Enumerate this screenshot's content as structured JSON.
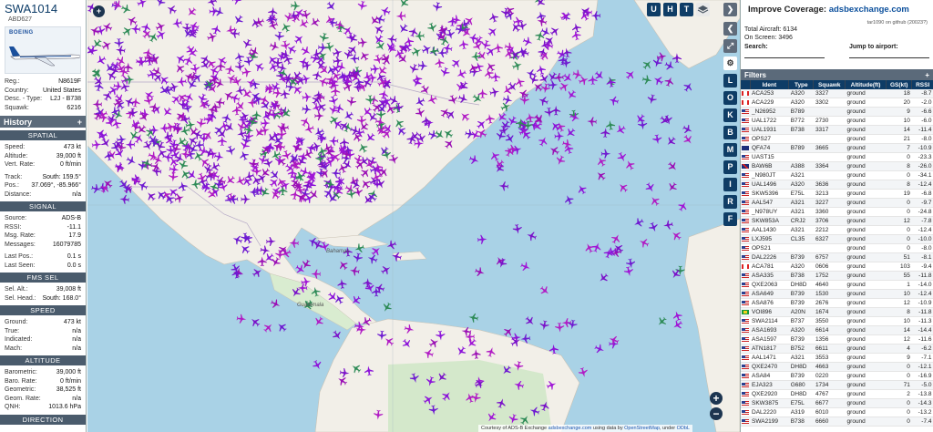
{
  "selected": {
    "callsign": "SWA1014",
    "hex": "ABD627",
    "airline_logo": "BOEING",
    "reg_label": "Reg.:",
    "reg": "N8619F",
    "country_label": "Country:",
    "country": "United States",
    "desc_label": "Desc. - Type:",
    "desc": "L2J - B738",
    "squawk_label": "Squawk:",
    "squawk": "6216"
  },
  "history": {
    "label": "History",
    "add": "+"
  },
  "spatial": {
    "title": "SPATIAL",
    "speed_label": "Speed:",
    "speed": "473 kt",
    "alt_label": "Altitude:",
    "alt": "39,000 ft",
    "vrate_label": "Vert. Rate:",
    "vrate": "0 ft/min",
    "track_label": "Track:",
    "track": "South: 159.5°",
    "pos_label": "Pos.:",
    "pos": "37.069°, -85.966°",
    "dist_label": "Distance:",
    "dist": "n/a"
  },
  "signal": {
    "title": "SIGNAL",
    "source_label": "Source:",
    "source": "ADS-B",
    "rssi_label": "RSSI:",
    "rssi": "-11.1",
    "msgrate_label": "Msg. Rate:",
    "msgrate": "17.9",
    "messages_label": "Messages:",
    "messages": "16079785",
    "lastpos_label": "Last Pos.:",
    "lastpos": "0.1 s",
    "lastseen_label": "Last Seen:",
    "lastseen": "0.0 s"
  },
  "fms": {
    "title": "FMS SEL",
    "selalt_label": "Sel. Alt.:",
    "selalt": "39,008 ft",
    "selhead_label": "Sel. Head.:",
    "selhead": "South: 168.0°"
  },
  "speedsec": {
    "title": "SPEED",
    "ground_label": "Ground:",
    "ground": "473 kt",
    "true_label": "True:",
    "true": "n/a",
    "ind_label": "Indicated:",
    "ind": "n/a",
    "mach_label": "Mach:",
    "mach": "n/a"
  },
  "altitude": {
    "title": "ALTITUDE",
    "baro_label": "Barometric:",
    "baro": "39,000 ft",
    "barorate_label": "Baro. Rate:",
    "barorate": "0 ft/min",
    "geom_label": "Geometric:",
    "geom": "38,525 ft",
    "geomrate_label": "Geom. Rate:",
    "geomrate": "n/a",
    "qnh_label": "QNH:",
    "qnh": "1013.6 hPa"
  },
  "direction": {
    "title": "DIRECTION"
  },
  "map_buttons": {
    "u": "U",
    "h": "H",
    "t": "T",
    "plus": "+",
    "minus": "−"
  },
  "side_buttons": [
    "L",
    "O",
    "K",
    "B",
    "M",
    "P",
    "I",
    "R",
    "F"
  ],
  "map_places": {
    "bahamas": "Bahamas",
    "guatemala": "Guatemala"
  },
  "attribution": {
    "prefix": "Courtesy of ADS-B Exchange",
    "link1": "adsbexchange.com",
    "mid": " using data by ",
    "link2": "OpenStreetMap",
    "suffix": ", under ",
    "link3": "ODbL"
  },
  "right": {
    "improve_prefix": "Improve Coverage: ",
    "improve_link": "adsbexchange.com",
    "version": "tar1090 on github (20023?)",
    "total_label": "Total Aircraft: ",
    "total": "6134",
    "onscreen_label": "On Screen: ",
    "onscreen": "3496",
    "search_label": "Search:",
    "jump_label": "Jump to airport:",
    "filters_label": "Filters",
    "filters_add": "+"
  },
  "columns": [
    "",
    "Ident",
    "Type",
    "Squawk",
    "Altitude(ft)",
    "GS(kt)",
    "RSSI"
  ],
  "rows": [
    {
      "f": "ca",
      "id": "ACA253",
      "type": "A320",
      "sq": "3327",
      "alt": "ground",
      "gs": "18",
      "rssi": "-8.7"
    },
    {
      "f": "ca",
      "id": "ACA229",
      "type": "A320",
      "sq": "3302",
      "alt": "ground",
      "gs": "20",
      "rssi": "-2.0"
    },
    {
      "f": "us",
      "id": "_N26952",
      "type": "B789",
      "sq": "",
      "alt": "ground",
      "gs": "9",
      "rssi": "-6.6"
    },
    {
      "f": "us",
      "id": "UAL1722",
      "type": "B772",
      "sq": "2730",
      "alt": "ground",
      "gs": "10",
      "rssi": "-6.0"
    },
    {
      "f": "us",
      "id": "UAL1931",
      "type": "B738",
      "sq": "3317",
      "alt": "ground",
      "gs": "14",
      "rssi": "-11.4"
    },
    {
      "f": "us",
      "id": "OPS27",
      "type": "",
      "sq": "",
      "alt": "ground",
      "gs": "21",
      "rssi": "-8.0"
    },
    {
      "f": "au",
      "id": "QFA74",
      "type": "B789",
      "sq": "3665",
      "alt": "ground",
      "gs": "7",
      "rssi": "-10.9"
    },
    {
      "f": "us",
      "id": "UAST15",
      "type": "",
      "sq": "",
      "alt": "ground",
      "gs": "0",
      "rssi": "-23.3"
    },
    {
      "f": "gb",
      "id": "BAW6B",
      "type": "A388",
      "sq": "3364",
      "alt": "ground",
      "gs": "8",
      "rssi": "-26.0"
    },
    {
      "f": "us",
      "id": "_N980JT",
      "type": "A321",
      "sq": "",
      "alt": "ground",
      "gs": "0",
      "rssi": "-34.1"
    },
    {
      "f": "us",
      "id": "UAL1496",
      "type": "A320",
      "sq": "3636",
      "alt": "ground",
      "gs": "8",
      "rssi": "-12.4"
    },
    {
      "f": "us",
      "id": "SKW5396",
      "type": "E75L",
      "sq": "3213",
      "alt": "ground",
      "gs": "19",
      "rssi": "-6.8"
    },
    {
      "f": "us",
      "id": "AAL547",
      "type": "A321",
      "sq": "3227",
      "alt": "ground",
      "gs": "0",
      "rssi": "-9.7"
    },
    {
      "f": "us",
      "id": "_N978UY",
      "type": "A321",
      "sq": "3360",
      "alt": "ground",
      "gs": "0",
      "rssi": "-24.8"
    },
    {
      "f": "us",
      "id": "SKW853A",
      "type": "CRJ2",
      "sq": "3706",
      "alt": "ground",
      "gs": "12",
      "rssi": "-7.8"
    },
    {
      "f": "us",
      "id": "AAL1430",
      "type": "A321",
      "sq": "2212",
      "alt": "ground",
      "gs": "0",
      "rssi": "-12.4"
    },
    {
      "f": "us",
      "id": "LXJ595",
      "type": "CL35",
      "sq": "6327",
      "alt": "ground",
      "gs": "0",
      "rssi": "-10.0"
    },
    {
      "f": "us",
      "id": "OPS21",
      "type": "",
      "sq": "",
      "alt": "ground",
      "gs": "0",
      "rssi": "-8.0"
    },
    {
      "f": "us",
      "id": "DAL2226",
      "type": "B739",
      "sq": "6757",
      "alt": "ground",
      "gs": "51",
      "rssi": "-8.1"
    },
    {
      "f": "ca",
      "id": "ACA781",
      "type": "A320",
      "sq": "0606",
      "alt": "ground",
      "gs": "103",
      "rssi": "-9.4"
    },
    {
      "f": "us",
      "id": "ASA335",
      "type": "B738",
      "sq": "1752",
      "alt": "ground",
      "gs": "55",
      "rssi": "-11.8"
    },
    {
      "f": "us",
      "id": "QXE2063",
      "type": "DH8D",
      "sq": "4640",
      "alt": "ground",
      "gs": "1",
      "rssi": "-14.0"
    },
    {
      "f": "us",
      "id": "ASA649",
      "type": "B739",
      "sq": "1530",
      "alt": "ground",
      "gs": "10",
      "rssi": "-12.4"
    },
    {
      "f": "us",
      "id": "ASA876",
      "type": "B739",
      "sq": "2676",
      "alt": "ground",
      "gs": "12",
      "rssi": "-10.9"
    },
    {
      "f": "br",
      "id": "VOI896",
      "type": "A20N",
      "sq": "1674",
      "alt": "ground",
      "gs": "8",
      "rssi": "-11.8"
    },
    {
      "f": "us",
      "id": "SWA2114",
      "type": "B737",
      "sq": "3550",
      "alt": "ground",
      "gs": "10",
      "rssi": "-11.3"
    },
    {
      "f": "us",
      "id": "ASA1693",
      "type": "A320",
      "sq": "6614",
      "alt": "ground",
      "gs": "14",
      "rssi": "-14.4"
    },
    {
      "f": "us",
      "id": "ASA1597",
      "type": "B739",
      "sq": "1356",
      "alt": "ground",
      "gs": "12",
      "rssi": "-11.6"
    },
    {
      "f": "us",
      "id": "ATN1817",
      "type": "B752",
      "sq": "6611",
      "alt": "ground",
      "gs": "4",
      "rssi": "-6.2"
    },
    {
      "f": "us",
      "id": "AAL1471",
      "type": "A321",
      "sq": "3553",
      "alt": "ground",
      "gs": "9",
      "rssi": "-7.1"
    },
    {
      "f": "us",
      "id": "QXE2470",
      "type": "DH8D",
      "sq": "4663",
      "alt": "ground",
      "gs": "0",
      "rssi": "-12.1"
    },
    {
      "f": "us",
      "id": "ASA84",
      "type": "B739",
      "sq": "0220",
      "alt": "ground",
      "gs": "0",
      "rssi": "-16.9"
    },
    {
      "f": "us",
      "id": "EJA323",
      "type": "G680",
      "sq": "1734",
      "alt": "ground",
      "gs": "71",
      "rssi": "-5.0"
    },
    {
      "f": "us",
      "id": "QXE2920",
      "type": "DH8D",
      "sq": "4767",
      "alt": "ground",
      "gs": "2",
      "rssi": "-13.8"
    },
    {
      "f": "us",
      "id": "SKW3875",
      "type": "E75L",
      "sq": "6677",
      "alt": "ground",
      "gs": "0",
      "rssi": "-14.3"
    },
    {
      "f": "us",
      "id": "DAL2220",
      "type": "A319",
      "sq": "6010",
      "alt": "ground",
      "gs": "0",
      "rssi": "-13.2"
    },
    {
      "f": "us",
      "id": "SWA2199",
      "type": "B738",
      "sq": "6660",
      "alt": "ground",
      "gs": "0",
      "rssi": "-7.4"
    }
  ]
}
